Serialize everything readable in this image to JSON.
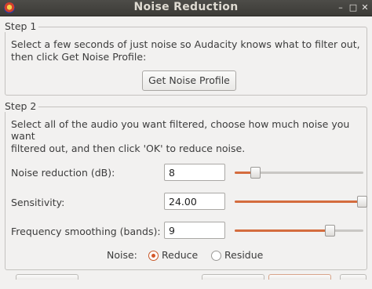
{
  "window": {
    "title": "Noise Reduction",
    "buttons": {
      "minimize": "–",
      "maximize": "□",
      "close": "✕"
    },
    "icon": "audacity-app-icon"
  },
  "step1": {
    "legend": "Step 1",
    "description_line1": "Select a few seconds of just noise so Audacity knows what to filter out,",
    "description_line2": "then click Get Noise Profile:",
    "button_label": "Get Noise Profile"
  },
  "step2": {
    "legend": "Step 2",
    "description_line1": "Select all of the audio you want filtered, choose how much noise you",
    "description_line2": "want",
    "description_line3": "filtered out, and then click 'OK' to reduce noise.",
    "controls": [
      {
        "label": "Noise reduction (dB):",
        "value": "8",
        "slider_fraction": 0.16
      },
      {
        "label": "Sensitivity:",
        "value": "24.00",
        "slider_fraction": 0.985
      },
      {
        "label": "Frequency smoothing (bands):",
        "value": "9",
        "slider_fraction": 0.74
      }
    ],
    "noise": {
      "label": "Noise:",
      "options": [
        {
          "label": "Reduce",
          "selected": true
        },
        {
          "label": "Residue",
          "selected": false
        }
      ]
    }
  },
  "colors": {
    "accent": "#d46c3e",
    "titlebar": "#3c3b37"
  }
}
